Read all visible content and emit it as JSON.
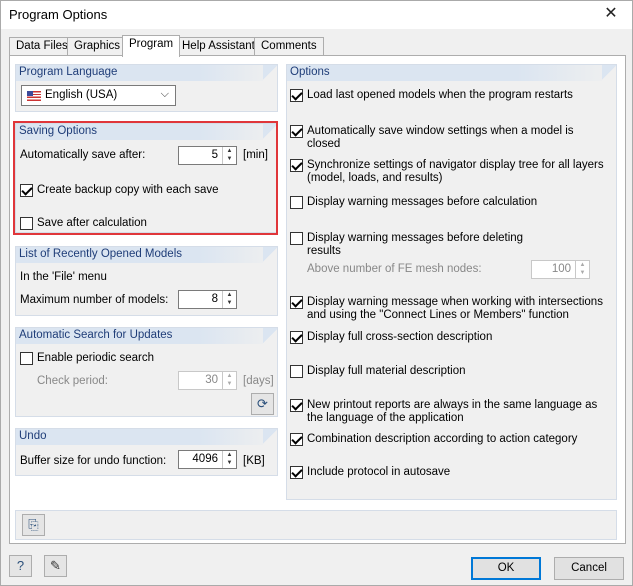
{
  "window": {
    "title": "Program Options",
    "close_glyph": "✕"
  },
  "tabs": [
    {
      "label": "Data Files"
    },
    {
      "label": "Graphics"
    },
    {
      "label": "Program",
      "active": true
    },
    {
      "label": "Help Assistant"
    },
    {
      "label": "Comments"
    }
  ],
  "program_language": {
    "header": "Program Language",
    "selected": "English (USA)"
  },
  "saving_options": {
    "header": "Saving Options",
    "autosave_label": "Automatically save after:",
    "autosave_value": "5",
    "autosave_unit": "[min]",
    "backup_label": "Create backup copy with each save",
    "backup_checked": true,
    "save_after_calc_label": "Save after calculation",
    "save_after_calc_checked": false
  },
  "recent_models": {
    "header": "List of Recently Opened Models",
    "menu_label": "In the 'File' menu",
    "max_label": "Maximum number of models:",
    "max_value": "8"
  },
  "updates": {
    "header": "Automatic Search for Updates",
    "enable_label": "Enable periodic search",
    "enable_checked": false,
    "period_label": "Check period:",
    "period_value": "30",
    "period_unit": "[days]"
  },
  "undo": {
    "header": "Undo",
    "buffer_label": "Buffer size for undo function:",
    "buffer_value": "4096",
    "buffer_unit": "[KB]"
  },
  "options": {
    "header": "Options",
    "items": [
      {
        "line1": "Load last opened models when the program restarts",
        "line2": "",
        "checked": true
      },
      {
        "line1": "Automatically save window settings when a model is",
        "line2": "closed",
        "checked": true
      },
      {
        "line1": "Synchronize settings of navigator display tree for all layers",
        "line2": "(model, loads, and results)",
        "checked": true
      },
      {
        "line1": "Display warning messages before calculation",
        "line2": "",
        "checked": false
      },
      {
        "line1": "Display warning messages before deleting",
        "line2": "results",
        "checked": false
      },
      {
        "line1": "Display warning message when working with intersections",
        "line2": "and using the \"Connect Lines or Members\" function",
        "checked": true
      },
      {
        "line1": "Display full cross-section description",
        "line2": "",
        "checked": true
      },
      {
        "line1": "Display full material description",
        "line2": "",
        "checked": false
      },
      {
        "line1": "New printout reports are always in the same language as",
        "line2": "the language of the application",
        "checked": true
      },
      {
        "line1": "Combination description according to action category",
        "line2": "",
        "checked": true
      },
      {
        "line1": "Include protocol in autosave",
        "line2": "",
        "checked": true
      }
    ],
    "fe_nodes_label": "Above number of FE mesh nodes:",
    "fe_nodes_value": "100"
  },
  "footer": {
    "ok_label": "OK",
    "cancel_label": "Cancel"
  },
  "icons": {
    "help": "help-icon",
    "edit": "edit-icon",
    "reset": "reset-icon",
    "update": "update-icon"
  }
}
